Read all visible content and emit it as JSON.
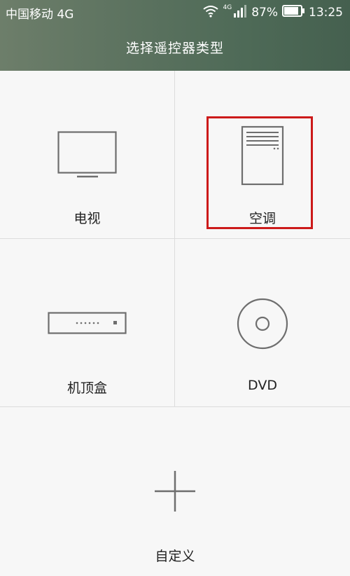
{
  "status_bar": {
    "carrier": "中国移动 4G",
    "network_small": "4G",
    "battery": "87%",
    "time": "13:25"
  },
  "header": {
    "title": "选择遥控器类型"
  },
  "devices": [
    {
      "id": "tv",
      "label": "电视",
      "icon": "tv-icon"
    },
    {
      "id": "ac",
      "label": "空调",
      "icon": "air-conditioner-icon",
      "highlighted": true
    },
    {
      "id": "stb",
      "label": "机顶盒",
      "icon": "set-top-box-icon"
    },
    {
      "id": "dvd",
      "label": "DVD",
      "icon": "disc-icon"
    },
    {
      "id": "custom",
      "label": "自定义",
      "icon": "plus-icon"
    }
  ],
  "colors": {
    "header_gradient_start": "#6d7e6a",
    "header_gradient_end": "#45604f",
    "icon_stroke": "#6e6e6e",
    "highlight": "#cc1a1a"
  }
}
